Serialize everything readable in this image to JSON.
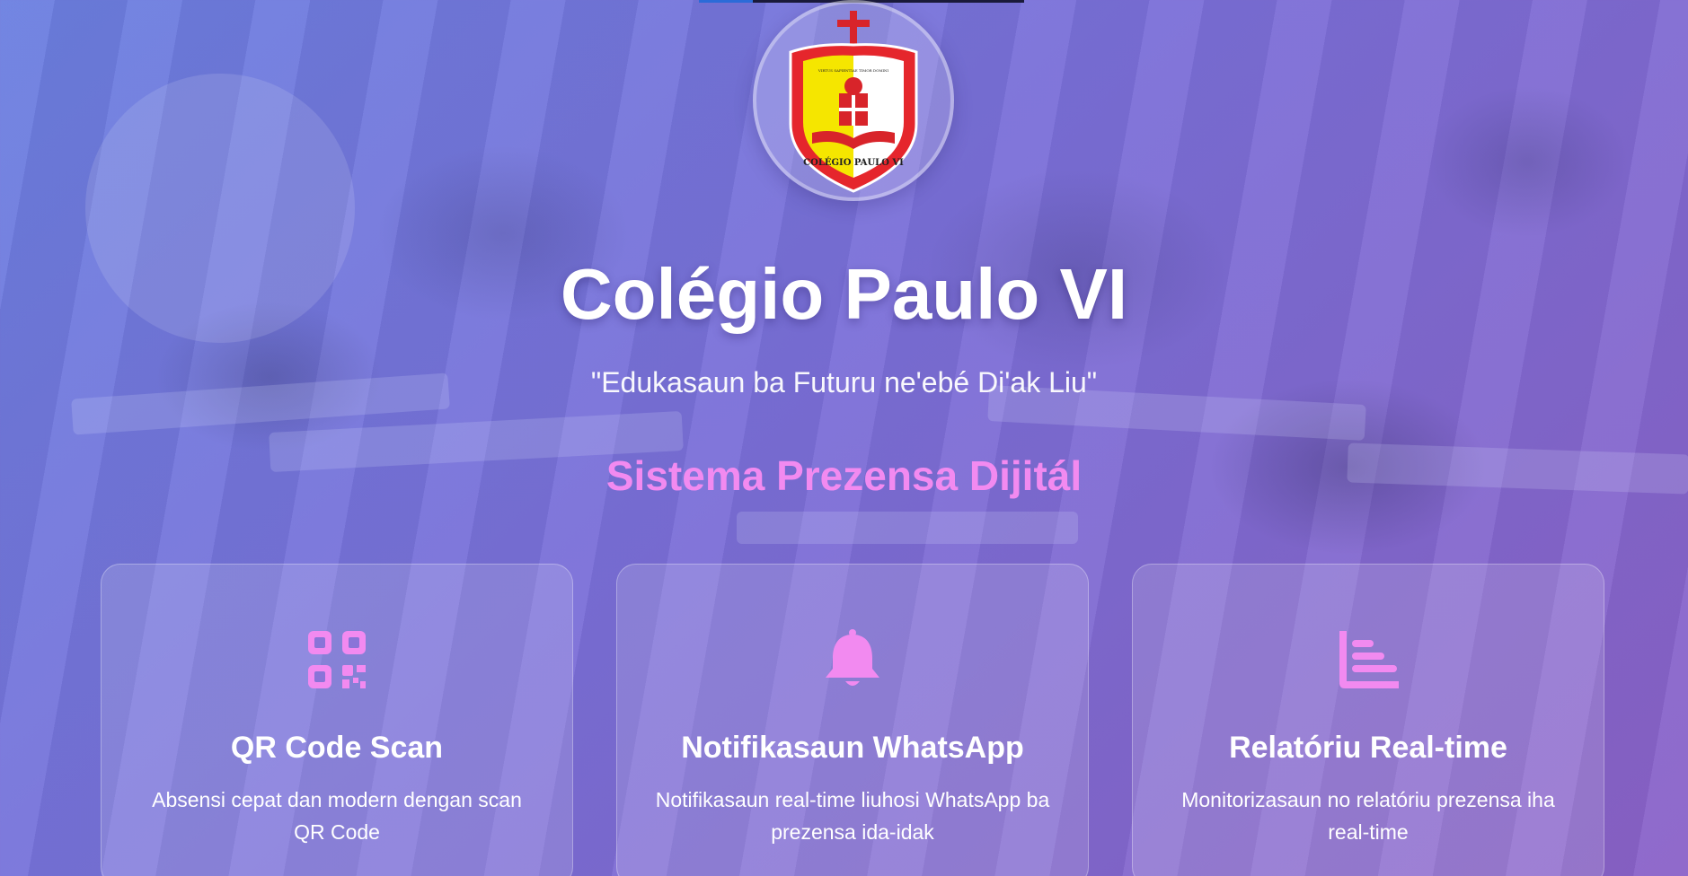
{
  "school": {
    "name": "Colégio Paulo VI",
    "tagline": "\"Edukasaun ba Futuru ne'ebé Di'ak Liu\"",
    "system_title": "Sistema Prezensa Dijitál",
    "logo_text": "COLÉGIO PAULO VI"
  },
  "features": [
    {
      "icon": "qr-code-icon",
      "title": "QR Code Scan",
      "description": "Absensi cepat dan modern dengan scan QR Code"
    },
    {
      "icon": "bell-icon",
      "title": "Notifikasaun WhatsApp",
      "description": "Notifikasaun real-time liuhosi WhatsApp ba prezensa ida-idak"
    },
    {
      "icon": "report-chart-icon",
      "title": "Relatóriu Real-time",
      "description": "Monitorizasaun no relatóriu prezensa iha real-time"
    }
  ],
  "colors": {
    "accent": "#f28af0",
    "background_start": "#6b7fe0",
    "background_end": "#8a62c8"
  }
}
